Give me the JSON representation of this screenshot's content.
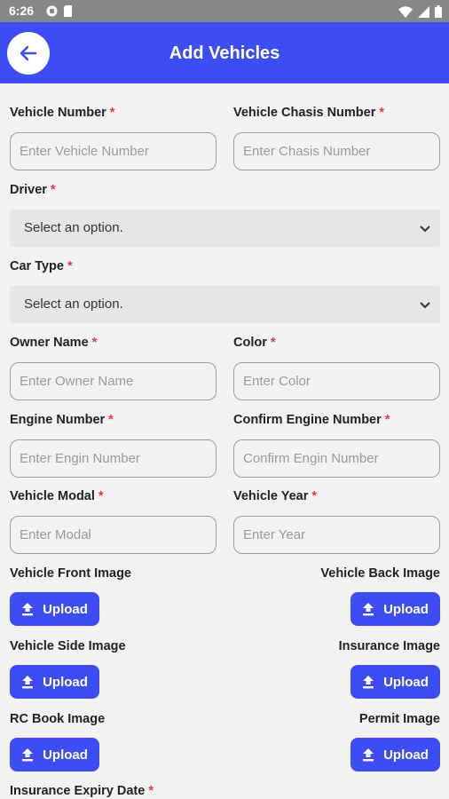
{
  "status_bar": {
    "time": "6:26",
    "left_icons": [
      "gamepad-icon",
      "sd-card-icon"
    ],
    "right_icons": [
      "wifi-icon",
      "signal-icon",
      "battery-icon"
    ]
  },
  "app_bar": {
    "title": "Add Vehicles",
    "back_icon": "arrow-left-icon",
    "accent_color": "#3c4ef3"
  },
  "form": {
    "required_marker": "*",
    "vehicle_number": {
      "label": "Vehicle Number",
      "placeholder": "Enter Vehicle Number"
    },
    "chasis_number": {
      "label": "Vehicle Chasis Number",
      "placeholder": "Enter Chasis Number"
    },
    "driver": {
      "label": "Driver",
      "value": "Select an option."
    },
    "car_type": {
      "label": "Car Type",
      "value": "Select an option."
    },
    "owner_name": {
      "label": "Owner Name",
      "placeholder": "Enter Owner Name"
    },
    "color": {
      "label": "Color",
      "placeholder": "Enter Color"
    },
    "engine_number": {
      "label": "Engine Number",
      "placeholder": "Enter Engin Number"
    },
    "confirm_engine_number": {
      "label": "Confirm Engine Number",
      "placeholder": "Confirm Engin Number"
    },
    "vehicle_modal": {
      "label": "Vehicle Modal",
      "placeholder": "Enter Modal"
    },
    "vehicle_year": {
      "label": "Vehicle Year",
      "placeholder": "Enter Year"
    },
    "insurance_expiry": {
      "label": "Insurance Expiry Date"
    }
  },
  "uploads": {
    "button_label": "Upload",
    "icon": "upload-icon",
    "front": {
      "label": "Vehicle Front Image"
    },
    "back": {
      "label": "Vehicle Back Image"
    },
    "side": {
      "label": "Vehicle Side Image"
    },
    "insurance": {
      "label": "Insurance Image"
    },
    "rc_book": {
      "label": "RC Book Image"
    },
    "permit": {
      "label": "Permit Image"
    }
  }
}
